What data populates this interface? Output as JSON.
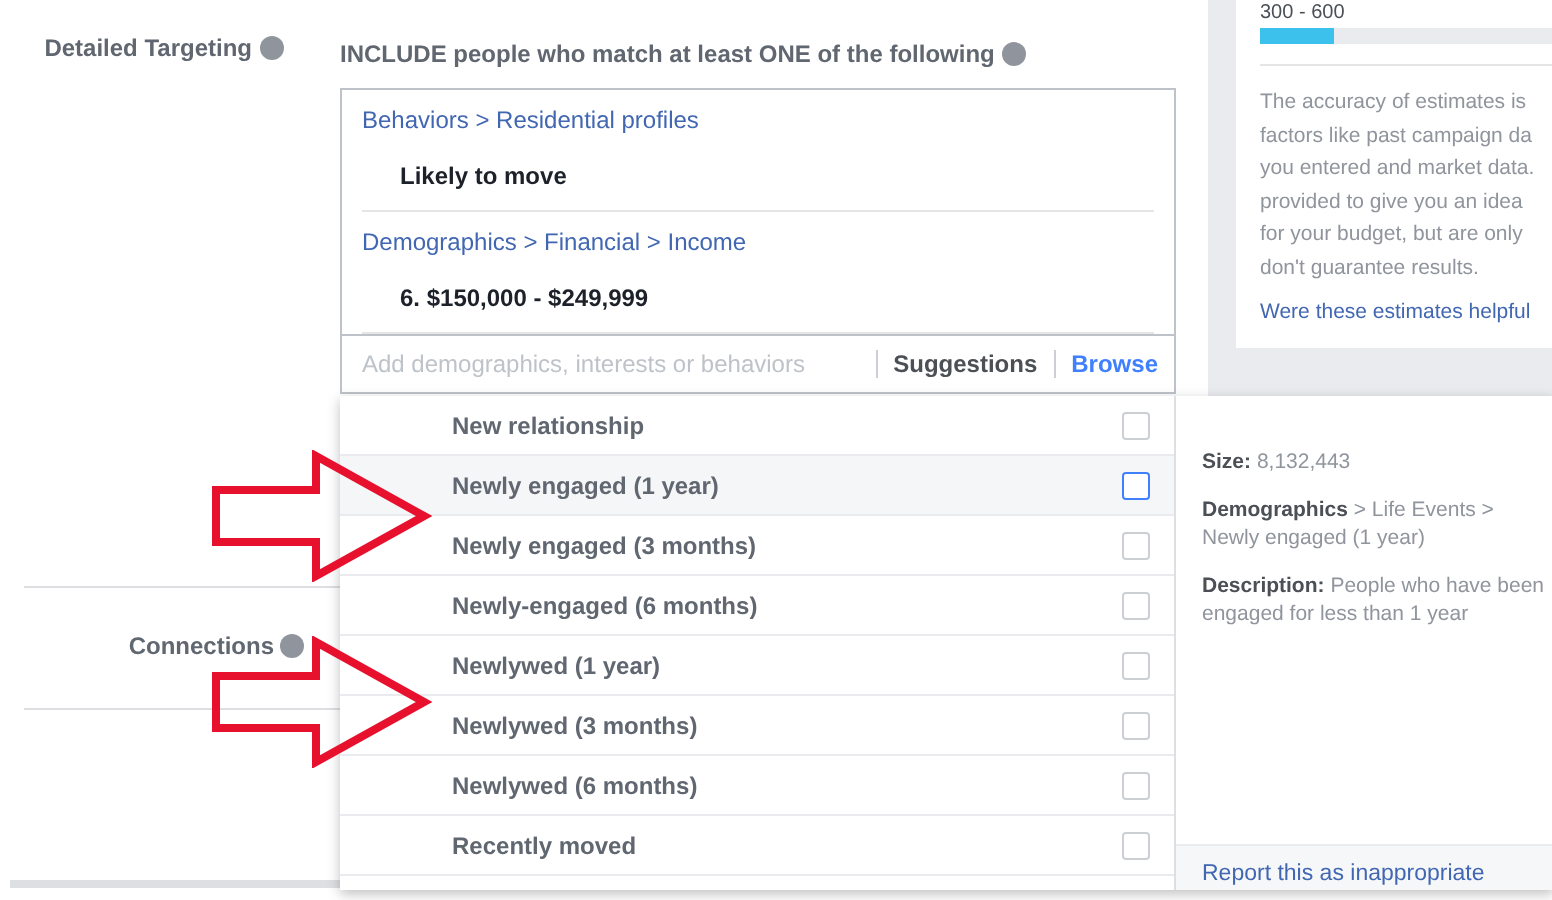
{
  "detailed_targeting": {
    "label": "Detailed Targeting",
    "include_text": "INCLUDE people who match at least ONE of the following",
    "groups": [
      {
        "path": "Behaviors > Residential profiles",
        "item": "Likely to move"
      },
      {
        "path": "Demographics > Financial > Income",
        "item": "6. $150,000 - $249,999"
      }
    ],
    "search": {
      "placeholder": "Add demographics, interests or behaviors"
    },
    "tabs": [
      {
        "label": "Suggestions",
        "selected": false
      },
      {
        "label": "Browse",
        "selected": true
      }
    ]
  },
  "connections": {
    "label": "Connections"
  },
  "estimates": {
    "range": "300 - 600",
    "level": 0.25,
    "lines": [
      "The accuracy of estimates is",
      "factors like past campaign da",
      "you entered and market data.",
      "provided to give you an idea",
      "for your budget, but are only",
      "don't guarantee results."
    ],
    "feedback_link": "Were these estimates helpful"
  },
  "dropdown": {
    "items": [
      {
        "label": "New relationship",
        "selected": false,
        "checked": false
      },
      {
        "label": "Newly engaged (1 year)",
        "selected": true,
        "checked": false
      },
      {
        "label": "Newly engaged (3 months)",
        "selected": false,
        "checked": false
      },
      {
        "label": "Newly-engaged (6 months)",
        "selected": false,
        "checked": false
      },
      {
        "label": "Newlywed (1 year)",
        "selected": false,
        "checked": false
      },
      {
        "label": "Newlywed (3 months)",
        "selected": false,
        "checked": false
      },
      {
        "label": "Newlywed (6 months)",
        "selected": false,
        "checked": false
      },
      {
        "label": "Recently moved",
        "selected": false,
        "checked": false
      }
    ]
  },
  "details": {
    "size_label": "Size:",
    "size": "8,132,443",
    "category": "Demographics",
    "path": "> Life Events > Newly engaged (1 year)",
    "description_label": "Description:",
    "description": "People who have been engaged for less than 1 year",
    "report_link": "Report this as inappropriate"
  },
  "annotations": [
    {
      "kind": "arrow"
    },
    {
      "kind": "arrow"
    }
  ]
}
